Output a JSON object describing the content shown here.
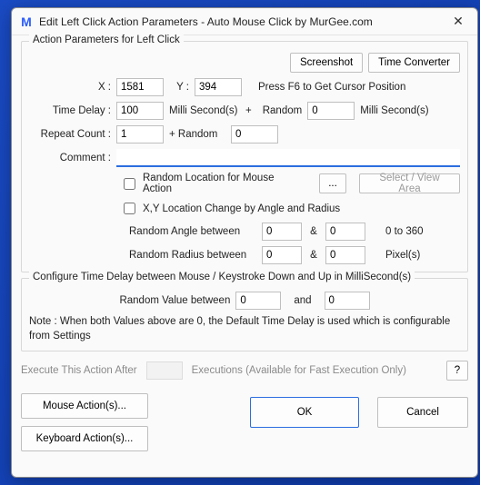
{
  "window": {
    "title": "Edit Left Click Action Parameters - Auto Mouse Click by MurGee.com"
  },
  "group1": {
    "title": "Action Parameters for Left Click",
    "screenshot_btn": "Screenshot",
    "timeconv_btn": "Time Converter",
    "x_label": "X :",
    "x_value": "1581",
    "y_label": "Y :",
    "y_value": "394",
    "press_f6": "Press F6 to Get Cursor Position",
    "time_delay_label": "Time Delay :",
    "time_delay_value": "100",
    "ms_label": "Milli Second(s)",
    "plus": "+",
    "random_label": "Random",
    "random_value": "0",
    "ms_label2": "Milli Second(s)",
    "repeat_label": "Repeat Count :",
    "repeat_value": "1",
    "plus_random": "+ Random",
    "repeat_random_value": "0",
    "comment_label": "Comment :",
    "comment_value": "",
    "random_location_chk": "Random Location for Mouse Action",
    "ellipsis_btn": "...",
    "select_view": "Select / View Area",
    "xy_change_chk": "X,Y Location Change by Angle and Radius",
    "rand_angle_label": "Random Angle between",
    "rand_angle_a": "0",
    "amp": "&",
    "rand_angle_b": "0",
    "zero_to_360": "0 to 360",
    "rand_radius_label": "Random Radius between",
    "rand_radius_a": "0",
    "rand_radius_b": "0",
    "pixels": "Pixel(s)"
  },
  "group2": {
    "title": "Configure Time Delay between Mouse / Keystroke Down and Up in MilliSecond(s)",
    "rand_val_label": "Random Value between",
    "rand_val_a": "0",
    "and": "and",
    "rand_val_b": "0",
    "note": "Note : When both Values above are 0, the Default Time Delay is used which is configurable from Settings"
  },
  "exec": {
    "label": "Execute This Action After",
    "value": "",
    "suffix": "Executions (Available for Fast Execution Only)",
    "help": "?"
  },
  "buttons": {
    "mouse": "Mouse Action(s)...",
    "keyboard": "Keyboard Action(s)...",
    "ok": "OK",
    "cancel": "Cancel"
  }
}
